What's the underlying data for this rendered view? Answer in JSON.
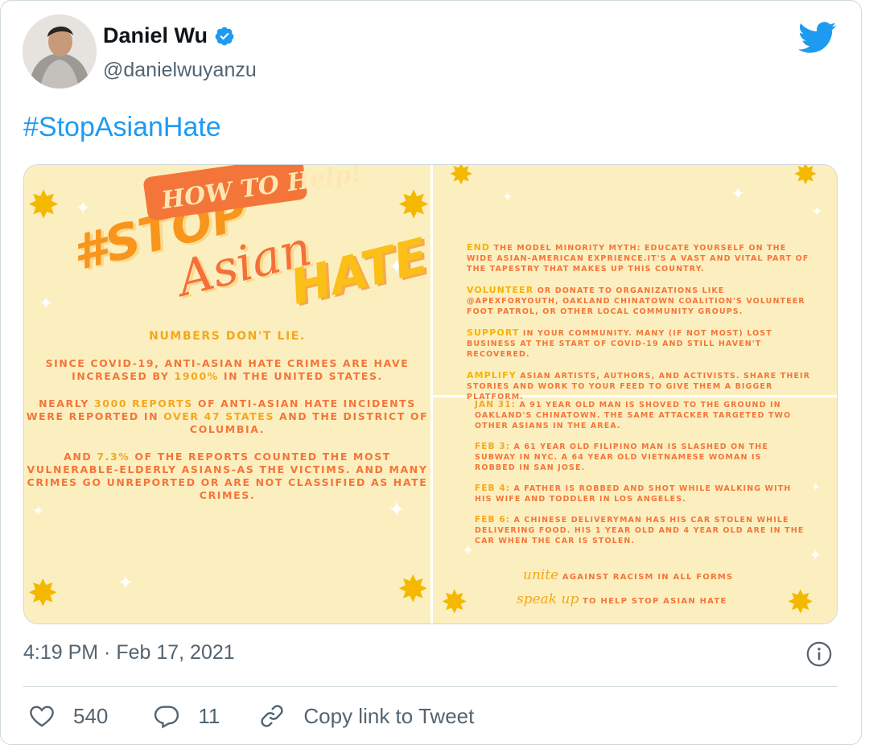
{
  "tweet": {
    "author_name": "Daniel Wu",
    "handle": "@danielwuyanzu",
    "hashtag": "#StopAsianHate",
    "timestamp": "4:19 PM · Feb 17, 2021",
    "likes": "540",
    "replies": "11",
    "copy_link_label": "Copy link to Tweet"
  },
  "colors": {
    "link_blue": "#1d9bf0",
    "secondary_text": "#536471",
    "graphic_bg": "#fcefbf",
    "graphic_orange": "#f4753a",
    "graphic_yellow": "#f5a71c"
  },
  "graphic_left": {
    "title_stop": "#STOP",
    "title_asian": "Asian",
    "title_hate": "HATE",
    "heading": "NUMBERS DON'T LIE.",
    "p1_a": "SINCE COVID-19, ANTI-ASIAN HATE CRIMES ARE HAVE INCREASED BY ",
    "p1_hl": "1900%",
    "p1_b": " IN THE UNITED STATES.",
    "p2_a": "NEARLY ",
    "p2_hl1": "3000 REPORTS",
    "p2_b": " OF ANTI-ASIAN HATE INCIDENTS WERE REPORTED IN ",
    "p2_hl2": "OVER 47 STATES",
    "p2_c": " AND THE DISTRICT OF COLUMBIA.",
    "p3_a": "AND ",
    "p3_hl": "7.3%",
    "p3_b": " OF THE REPORTS COUNTED THE MOST VULNERABLE-ELDERLY ASIANS-AS THE VICTIMS. AND MANY CRIMES GO UNREPORTED OR ARE NOT CLASSIFIED AS HATE CRIMES."
  },
  "graphic_right_top": {
    "title": "HOW TO Help!",
    "items": [
      {
        "kw": "END",
        "text": " THE MODEL MINORITY MYTH: EDUCATE YOURSELF ON THE WIDE ASIAN-AMERICAN EXPRIENCE.IT'S A VAST AND VITAL PART OF THE TAPESTRY THAT MAKES UP THIS COUNTRY."
      },
      {
        "kw": "VOLUNTEER",
        "text": " OR DONATE TO ORGANIZATIONS LIKE @APEXFORYOUTH, OAKLAND CHINATOWN COALITION'S VOLUNTEER FOOT PATROL, OR OTHER LOCAL COMMUNITY GROUPS."
      },
      {
        "kw": "SUPPORT",
        "text": " IN YOUR COMMUNITY. MANY (IF NOT MOST) LOST BUSINESS AT THE START OF COVID-19 AND STILL HAVEN'T RECOVERED."
      },
      {
        "kw": "AMPLIFY",
        "text": " ASIAN ARTISTS, AUTHORS, AND ACTIVISTS. SHARE THEIR STORIES AND WORK TO YOUR FEED TO GIVE THEM A BIGGER PLATFORM."
      }
    ]
  },
  "graphic_right_bottom": {
    "items": [
      {
        "kw": "JAN 31:",
        "text": " A 91 YEAR OLD MAN IS SHOVED TO THE GROUND IN OAKLAND'S CHINATOWN. THE SAME ATTACKER TARGETED TWO OTHER ASIANS IN THE AREA."
      },
      {
        "kw": "FEB 3:",
        "text": " A 61 YEAR OLD FILIPINO MAN IS SLASHED ON THE SUBWAY IN NYC. A 64 YEAR OLD VIETNAMESE WOMAN IS ROBBED IN SAN JOSE."
      },
      {
        "kw": "FEB 4:",
        "text": " A FATHER IS ROBBED AND SHOT WHILE WALKING WITH HIS WIFE AND TODDLER IN LOS ANGELES."
      },
      {
        "kw": "FEB 6:",
        "text": " A CHINESE DELIVERYMAN HAS HIS CAR STOLEN WHILE DELIVERING FOOD. HIS 1 YEAR OLD AND 4 YEAR OLD ARE IN THE CAR WHEN THE CAR IS STOLEN."
      }
    ],
    "unite_word": "unite",
    "unite_text": "AGAINST RACISM IN ALL FORMS",
    "speak_word": "speak up",
    "speak_text": "TO HELP STOP ASIAN HATE"
  }
}
